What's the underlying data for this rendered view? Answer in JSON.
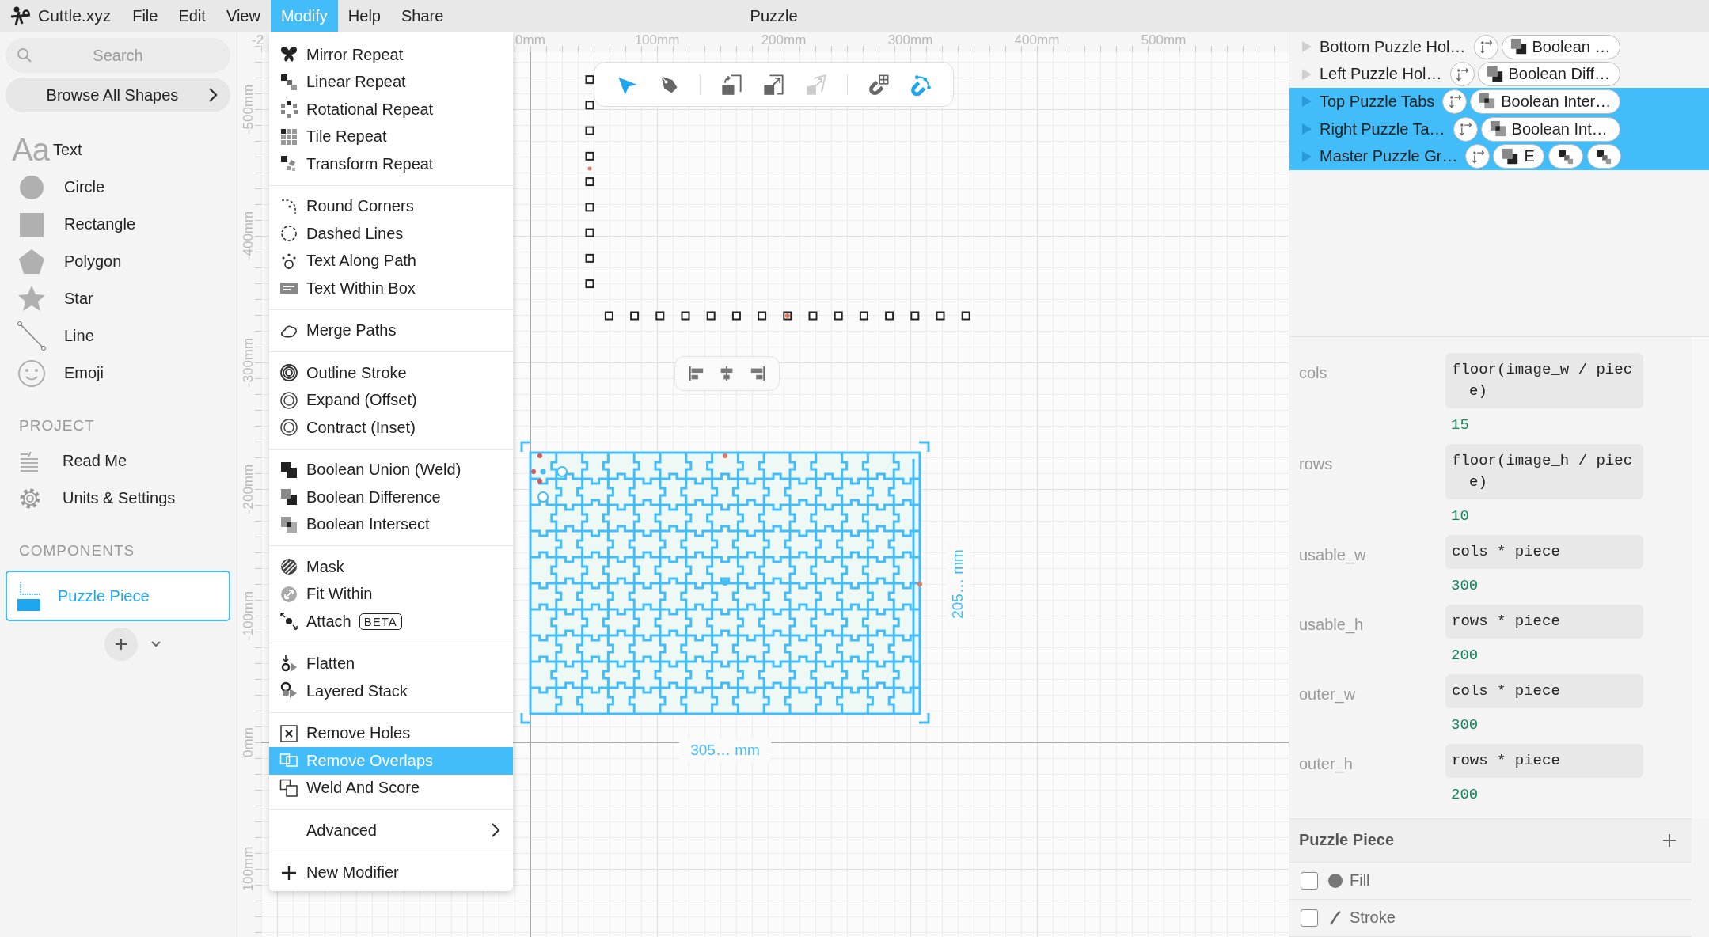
{
  "app": {
    "name": "Cuttle.xyz",
    "title": "Puzzle",
    "menus": [
      {
        "label": "File",
        "selected": false
      },
      {
        "label": "Edit",
        "selected": false
      },
      {
        "label": "View",
        "selected": false
      },
      {
        "label": "Modify",
        "selected": true
      },
      {
        "label": "Help",
        "selected": false
      },
      {
        "label": "Share",
        "selected": false
      }
    ]
  },
  "sidebar": {
    "search": {
      "placeholder": "Search"
    },
    "browse_button": "Browse All Shapes",
    "shapes": [
      {
        "label": "Text",
        "icon_text": "Aa"
      },
      {
        "label": "Circle"
      },
      {
        "label": "Rectangle"
      },
      {
        "label": "Polygon"
      },
      {
        "label": "Star"
      },
      {
        "label": "Line"
      },
      {
        "label": "Emoji"
      }
    ],
    "project_title": "PROJECT",
    "project_items": [
      {
        "label": "Read Me"
      },
      {
        "label": "Units & Settings"
      }
    ],
    "components_title": "COMPONENTS",
    "components": [
      {
        "label": "Puzzle Piece",
        "selected": true
      }
    ]
  },
  "modify_menu": {
    "groups": [
      [
        {
          "label": "Mirror Repeat",
          "selected": false
        },
        {
          "label": "Linear Repeat",
          "selected": false
        },
        {
          "label": "Rotational Repeat",
          "selected": false
        },
        {
          "label": "Tile Repeat",
          "selected": false
        },
        {
          "label": "Transform Repeat",
          "selected": false
        }
      ],
      [
        {
          "label": "Round Corners",
          "selected": false
        },
        {
          "label": "Dashed Lines",
          "selected": false
        },
        {
          "label": "Text Along Path",
          "selected": false
        },
        {
          "label": "Text Within Box",
          "selected": false
        }
      ],
      [
        {
          "label": "Merge Paths",
          "selected": false
        }
      ],
      [
        {
          "label": "Outline Stroke",
          "selected": false
        },
        {
          "label": "Expand (Offset)",
          "selected": false
        },
        {
          "label": "Contract (Inset)",
          "selected": false
        }
      ],
      [
        {
          "label": "Boolean Union (Weld)",
          "selected": false
        },
        {
          "label": "Boolean Difference",
          "selected": false
        },
        {
          "label": "Boolean Intersect",
          "selected": false
        }
      ],
      [
        {
          "label": "Mask",
          "selected": false
        },
        {
          "label": "Fit Within",
          "selected": false
        },
        {
          "label": "Attach",
          "selected": false,
          "badge": "BETA"
        }
      ],
      [
        {
          "label": "Flatten",
          "selected": false
        },
        {
          "label": "Layered Stack",
          "selected": false
        }
      ],
      [
        {
          "label": "Remove Holes",
          "selected": false
        },
        {
          "label": "Remove Overlaps",
          "selected": true
        },
        {
          "label": "Weld And Score",
          "selected": false
        }
      ],
      [
        {
          "label": "Advanced",
          "selected": false,
          "submenu": true
        }
      ],
      [
        {
          "label": "New Modifier",
          "selected": false
        }
      ]
    ]
  },
  "canvas": {
    "top_ruler": [
      "-2",
      "0mm",
      "100mm",
      "200mm",
      "300mm",
      "400mm",
      "500mm"
    ],
    "left_ruler": [
      "-500mm",
      "-400mm",
      "-300mm",
      "-200mm",
      "-100mm",
      "0mm",
      "100mm"
    ],
    "tools": [
      {
        "active": true,
        "disabled": false
      },
      {
        "active": false,
        "disabled": false
      },
      {
        "active": false,
        "disabled": false
      },
      {
        "active": false,
        "disabled": false
      },
      {
        "active": false,
        "disabled": true
      },
      {
        "active": false,
        "disabled": false
      },
      {
        "active": true,
        "disabled": false
      }
    ],
    "width_label": "305… mm",
    "height_label": "205… mm"
  },
  "layers": [
    {
      "name": "Bottom Puzzle Hol…",
      "selected": false,
      "expanded": false,
      "modifiers": [
        {
          "label": "Boolean …",
          "kind": "difference"
        }
      ]
    },
    {
      "name": "Left Puzzle Hol…",
      "selected": false,
      "expanded": false,
      "modifiers": [
        {
          "label": "Boolean Diff…",
          "kind": "difference"
        }
      ]
    },
    {
      "name": "Top Puzzle Tabs",
      "selected": true,
      "expanded": false,
      "modifiers": [
        {
          "label": "Boolean Inter…",
          "kind": "intersect"
        }
      ]
    },
    {
      "name": "Right Puzzle Ta…",
      "selected": true,
      "expanded": false,
      "modifiers": [
        {
          "label": "Boolean Int…",
          "kind": "intersect"
        }
      ]
    },
    {
      "name": "Master Puzzle Gr…",
      "selected": true,
      "expanded": false,
      "modifiers": [
        {
          "label": "E",
          "kind": "difference"
        },
        {
          "kind": "repeat"
        },
        {
          "kind": "repeat"
        }
      ]
    }
  ],
  "variables": [
    {
      "name": "cols",
      "expression": "floor(image_w / piece)",
      "value": "15"
    },
    {
      "name": "rows",
      "expression": "floor(image_h / piece)",
      "value": "10"
    },
    {
      "name": "usable_w",
      "expression": "cols * piece",
      "value": "300"
    },
    {
      "name": "usable_h",
      "expression": "rows * piece",
      "value": "200"
    },
    {
      "name": "outer_w",
      "expression": "cols * piece",
      "value": "300"
    },
    {
      "name": "outer_h",
      "expression": "rows * piece",
      "value": "200"
    }
  ],
  "component": {
    "title": "Puzzle Piece",
    "properties": [
      {
        "label": "Fill",
        "kind": "fill",
        "checked": false
      },
      {
        "label": "Stroke",
        "kind": "stroke",
        "checked": false
      }
    ]
  }
}
